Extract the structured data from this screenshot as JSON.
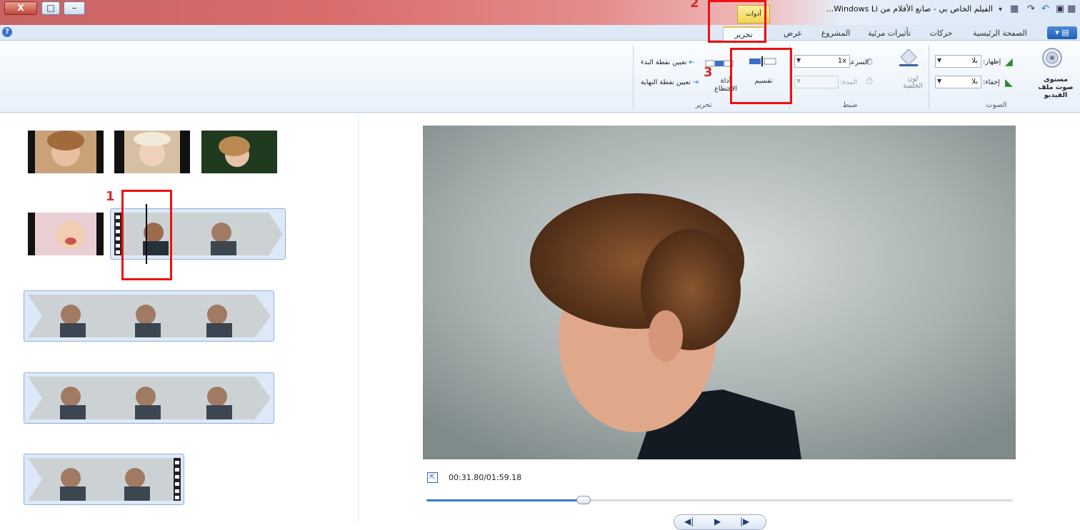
{
  "window": {
    "title": "الفيلم الخاص بي - صانع الأفلام من Windows Li...",
    "context_tab": "أدوات الفيديو",
    "close_label": "X",
    "max_label": "□",
    "min_label": "–"
  },
  "tabs": {
    "file_label": "▾ ▤",
    "items": [
      {
        "label": "الصفحة الرئيسية"
      },
      {
        "label": "حركات"
      },
      {
        "label": "تأثيرات مرئية"
      },
      {
        "label": "المشروع"
      },
      {
        "label": "عرض"
      },
      {
        "label": "تحرير"
      }
    ],
    "active": "تحرير"
  },
  "ribbon": {
    "audio": {
      "volume_label": "مستوى صوت ملف الفيديو",
      "fade_in_label": "إظهار:",
      "fade_in_value": "بلا",
      "fade_out_label": "إخفاء:",
      "fade_out_value": "بلا",
      "group_label": "الصوت"
    },
    "adjust": {
      "bg_color_label": "لون الخلفية",
      "speed_label": "السرعة:",
      "speed_value": "1x",
      "duration_label": "المدة:",
      "duration_value": "",
      "group_label": "ضبط"
    },
    "edit": {
      "split_label": "تقسيم",
      "trim_tool_label": "أداة الاقتطاع",
      "set_start_label": "تعيين نقطة البدء",
      "set_end_label": "تعيين نقطة النهاية",
      "group_label": "تحرير"
    }
  },
  "annotations": {
    "one": "1",
    "two": "2",
    "three": "3"
  },
  "player": {
    "time": "00:31.80/01:59.18",
    "progress_fraction": 0.268
  },
  "colors": {
    "accent": "#3b77cf",
    "annotation_red": "#e11111",
    "context_tab": "#f2d550"
  }
}
